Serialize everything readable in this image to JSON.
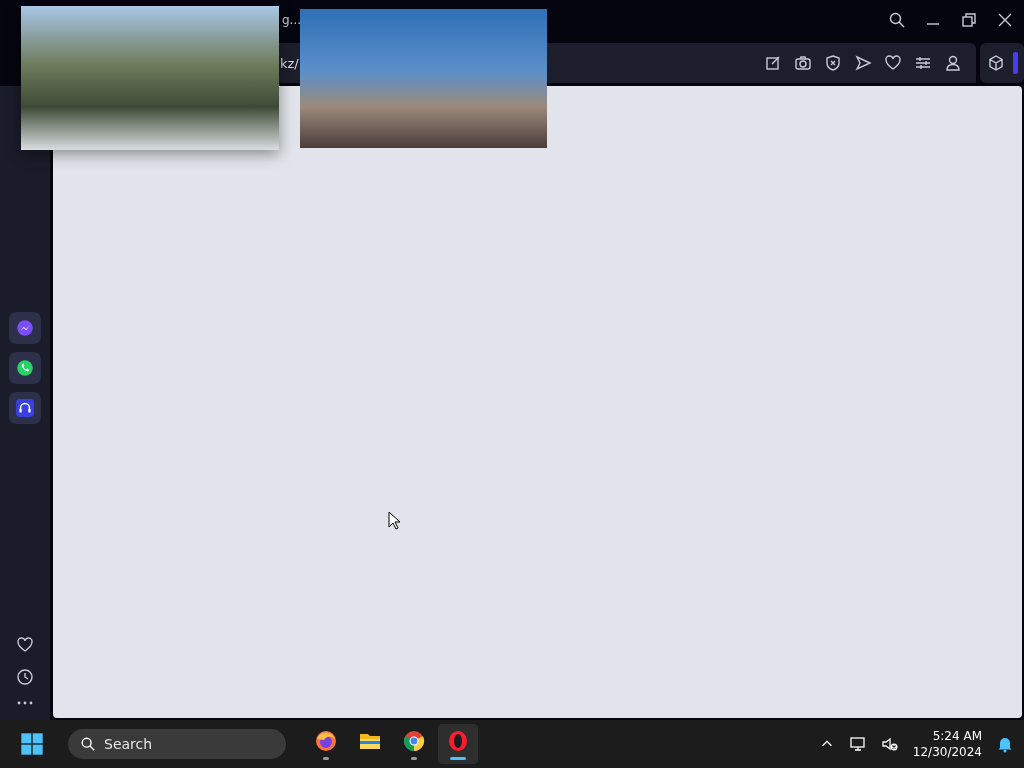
{
  "browser": {
    "tab_title": "g...",
    "address": "kz/",
    "sidebar_apps": [
      {
        "kind": "messenger"
      },
      {
        "kind": "whatsapp"
      },
      {
        "kind": "music"
      }
    ]
  },
  "taskbar": {
    "search": {
      "placeholder": "Search"
    },
    "apps": [
      {
        "kind": "firefox",
        "running": true,
        "selected": false
      },
      {
        "kind": "files",
        "running": false,
        "selected": false
      },
      {
        "kind": "chrome",
        "running": true,
        "selected": false
      },
      {
        "kind": "opera",
        "running": true,
        "selected": true
      }
    ],
    "time": "5:24 AM",
    "date": "12/30/2024"
  }
}
